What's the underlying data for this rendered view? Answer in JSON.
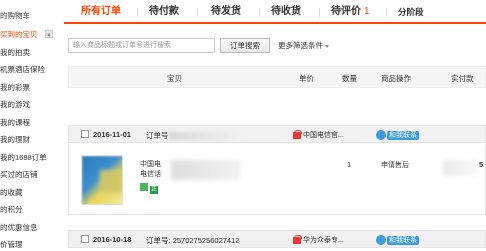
{
  "sidebar": {
    "items": [
      {
        "label": "的购物车",
        "active": false
      },
      {
        "label": "买到的宝贝",
        "active": true
      },
      {
        "label": "我的拍卖",
        "active": false
      },
      {
        "label": "机票酒店保险",
        "active": false
      },
      {
        "label": "我的彩票",
        "active": false
      },
      {
        "label": "我的游戏",
        "active": false
      },
      {
        "label": "我的课程",
        "active": false
      },
      {
        "label": "我的理财",
        "active": false
      },
      {
        "label": "我的1688订单",
        "active": false
      },
      {
        "label": "买过的店铺",
        "active": false
      },
      {
        "label": "的收藏",
        "active": false
      },
      {
        "label": "的积分",
        "active": false
      },
      {
        "label": "的优惠信息",
        "active": false
      },
      {
        "label": "价管理",
        "active": false
      }
    ]
  },
  "tabs": [
    {
      "label": "所有订单",
      "active": true,
      "badge": ""
    },
    {
      "label": "待付款",
      "active": false,
      "badge": ""
    },
    {
      "label": "待发货",
      "active": false,
      "badge": ""
    },
    {
      "label": "待收货",
      "active": false,
      "badge": ""
    },
    {
      "label": "待评价",
      "active": false,
      "badge": "1"
    },
    {
      "label": "分阶段",
      "active": false,
      "badge": ""
    }
  ],
  "search": {
    "placeholder": "输入商品标题或订单号进行搜索",
    "button_label": "订单搜索",
    "more_filters_label": "更多筛选条件"
  },
  "columns": {
    "item": "宝贝",
    "unit_price": "单价",
    "quantity": "数量",
    "item_actions": "商品操作",
    "paid": "实付款"
  },
  "orders": [
    {
      "date": "2016-11-01",
      "order_no_label": "订单号",
      "order_no": "",
      "shop": "中国电信官...",
      "contact": "和我联系",
      "product": {
        "title_line1": "中国电",
        "title_line2": "电信话",
        "quantity": "1",
        "action": "申请售后",
        "price_tail": "5"
      }
    },
    {
      "date": "2016-10-18",
      "order_no_label": "订单号:",
      "order_no": "2570275256027412",
      "shop": "华为众泰专...",
      "contact": "和我联系"
    }
  ],
  "colors": {
    "accent": "#ff4400",
    "contact_blue": "#3a9be0",
    "header_bg": "#f5f5f5"
  }
}
